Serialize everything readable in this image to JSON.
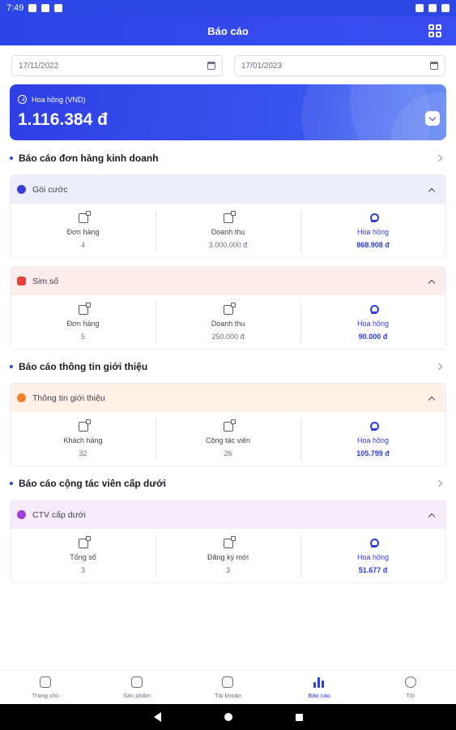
{
  "status_bar": {
    "time": "7:49"
  },
  "app_bar": {
    "title": "Báo cáo"
  },
  "date_range": {
    "from": "17/11/2022",
    "to": "17/01/2023"
  },
  "commission": {
    "label": "Hoa hồng (VND)",
    "amount": "1.116.384 đ"
  },
  "sections": {
    "business": "Báo cáo đơn hàng kinh doanh",
    "referral": "Báo cáo thông tin giới thiệu",
    "subagents": "Báo cáo cộng tác viên cấp dưới"
  },
  "groups": {
    "package": {
      "title": "Gói cước",
      "color": "#eeeefb",
      "stats": [
        {
          "label": "Đơn hàng",
          "value": "4"
        },
        {
          "label": "Doanh thu",
          "value": "3.000.000 đ"
        },
        {
          "label": "Hoa hồng",
          "value": "868.908 đ"
        }
      ]
    },
    "sim": {
      "title": "Sim số",
      "color": "#fdecec",
      "stats": [
        {
          "label": "Đơn hàng",
          "value": "5"
        },
        {
          "label": "Doanh thu",
          "value": "250.000 đ"
        },
        {
          "label": "Hoa hồng",
          "value": "90.000 đ"
        }
      ]
    },
    "referral": {
      "title": "Thông tin giới thiệu",
      "color": "#fff0e8",
      "stats": [
        {
          "label": "Khách hàng",
          "value": "32"
        },
        {
          "label": "Cộng tác viên",
          "value": "26"
        },
        {
          "label": "Hoa hồng",
          "value": "105.799 đ"
        }
      ]
    },
    "subagents": {
      "title": "CTV cấp dưới",
      "color": "#f5ebfb",
      "stats": [
        {
          "label": "Tổng số",
          "value": "3"
        },
        {
          "label": "Đăng ký mới",
          "value": "3"
        },
        {
          "label": "Hoa hồng",
          "value": "51.677 đ"
        }
      ]
    }
  },
  "bottom_nav": {
    "items": [
      {
        "label": "Trang chủ",
        "icon": "home-icon"
      },
      {
        "label": "Sản phẩm",
        "icon": "box-icon"
      },
      {
        "label": "Tài khoản",
        "icon": "wallet-icon"
      },
      {
        "label": "Báo cáo",
        "icon": "chart-icon",
        "active": true
      },
      {
        "label": "Tôi",
        "icon": "user-icon"
      }
    ]
  },
  "colors": {
    "primary": "#2d46e6",
    "accent": "#2d3be0"
  }
}
